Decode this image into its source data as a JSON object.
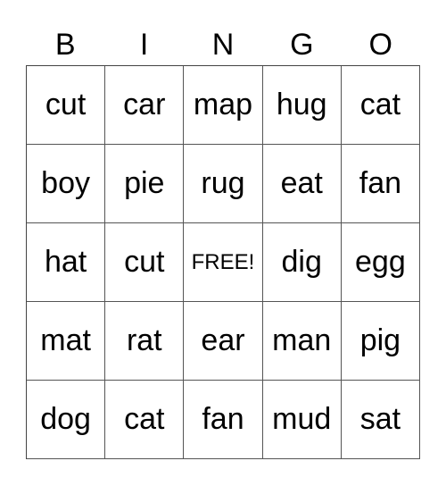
{
  "header": [
    "B",
    "I",
    "N",
    "G",
    "O"
  ],
  "cells": [
    [
      "cut",
      "car",
      "map",
      "hug",
      "cat"
    ],
    [
      "boy",
      "pie",
      "rug",
      "eat",
      "fan"
    ],
    [
      "hat",
      "cut",
      "FREE!",
      "dig",
      "egg"
    ],
    [
      "mat",
      "rat",
      "ear",
      "man",
      "pig"
    ],
    [
      "dog",
      "cat",
      "fan",
      "mud",
      "sat"
    ]
  ]
}
